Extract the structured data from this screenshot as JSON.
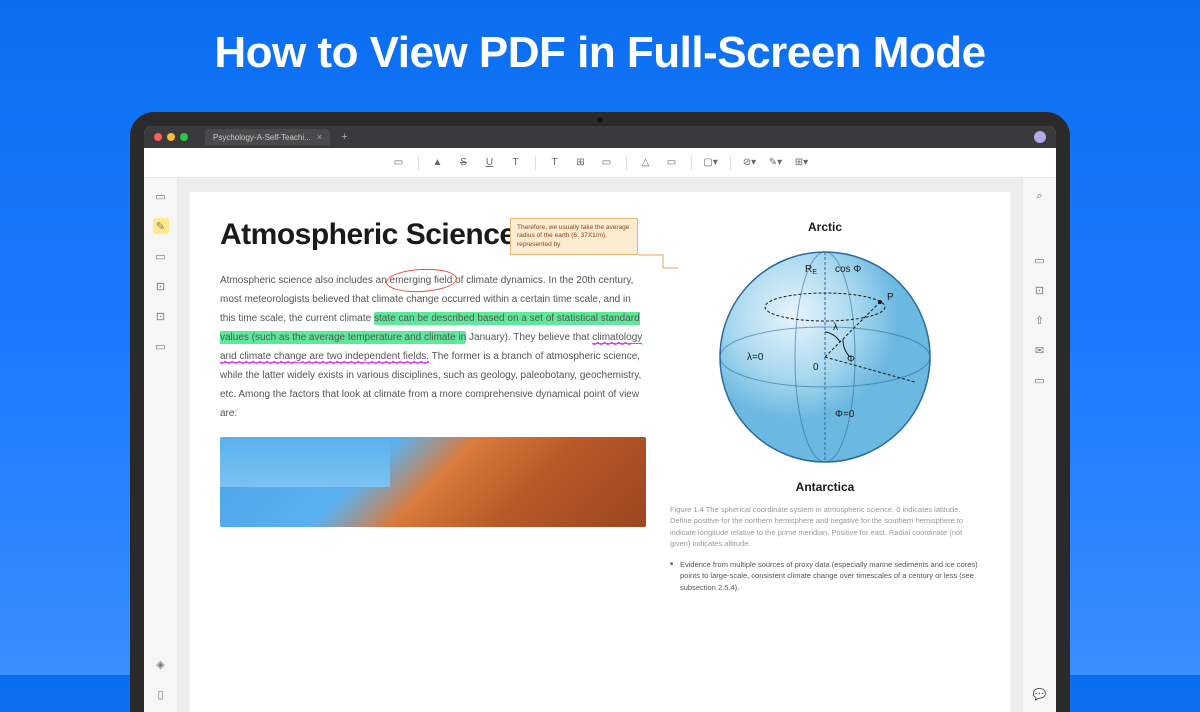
{
  "banner": {
    "title": "How to View PDF in Full-Screen Mode"
  },
  "window": {
    "tab_title": "Psychology-A-Self-Teachi..."
  },
  "document": {
    "heading": "Atmospheric Science",
    "body_p1_a": "Atmospheric science also includes an ",
    "body_circled": "emerging field",
    "body_p1_b": " of climate dynamics. In the 20th century, most meteorologists believed that climate change occurred within a certain time scale, and in this time scale, the current climate ",
    "body_hl": "state can be described based on a set of statistical standard values (such as the average temperature and climate in",
    "body_p1_c": " January). They believe that ",
    "body_underline": "climatology and climate change are two independent fields.",
    "body_p1_d": " The former is a branch of atmospheric science, while the latter widely exists in various disciplines, such as geology, paleobotany, geochemistry, etc. Among the factors that look at climate from a more comprehensive dynamical point of view are:",
    "note": "Therefore, we usually take the average radius of the earth (6. 37X1/m), represented by",
    "globe_top": "Arctic",
    "globe_bottom": "Antarctica",
    "globe_labels": {
      "re": "R",
      "e_sub": "E",
      "cos": "cos Φ",
      "lambda": "λ",
      "p": "P",
      "lambda0": "λ=0",
      "origin": "0",
      "phi": "Φ",
      "phi0": "Φ=0"
    },
    "figure_caption": "Figure 1.4 The spherical coordinate system in atmospheric science. 0 indicates latitude. Define positive for the northern hemisphere and negative for the southern hemisphere to indicate longitude relative to the prime meridian. Positive for east. Radial coordinate (not given) indicates altitude.",
    "bullet": "Evidence from multiple sources of proxy data (especially marine sediments and ice cores) points to large-scale, consistent climate change over timescales of a century or less (see subsection 2.5.4)."
  }
}
